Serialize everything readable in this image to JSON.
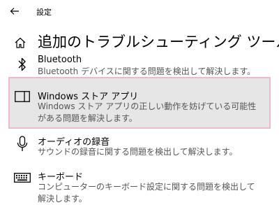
{
  "window": {
    "title": "設定"
  },
  "page": {
    "title": "追加のトラブルシューティング ツール"
  },
  "items": [
    {
      "icon": "bluetooth-icon",
      "name": "Bluetooth",
      "description": "Bluetooth デバイスに関する問題を検出して解決します。"
    },
    {
      "icon": "windows-store-app-icon",
      "name": "Windows ストア アプリ",
      "description": "Windows ストア アプリの正しい動作を妨げている可能性がある問題を解決します。",
      "selected": true
    },
    {
      "icon": "microphone-icon",
      "name": "オーディオの録音",
      "description": "サウンドの録音に関する問題を検出して解決します。"
    },
    {
      "icon": "keyboard-icon",
      "name": "キーボード",
      "description": "コンピューターのキーボード設定に関する問題を検出して解決します。"
    }
  ],
  "colors": {
    "selected_background": "#e6e6e6",
    "selected_border": "#f0b8cf"
  }
}
